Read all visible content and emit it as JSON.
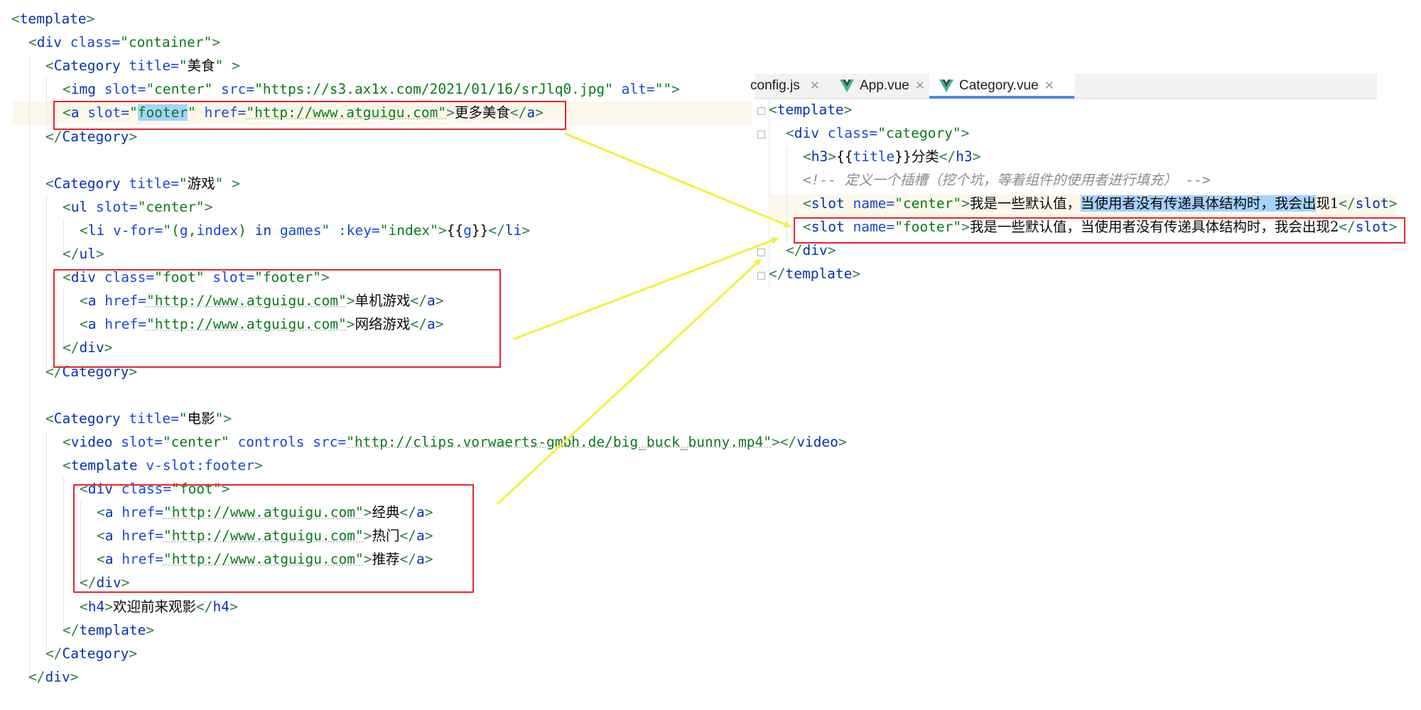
{
  "left_code": [
    [
      {
        "t": "<",
        "c": "bracket"
      },
      {
        "t": "template",
        "c": "tag"
      },
      {
        "t": ">",
        "c": "bracket"
      }
    ],
    [
      {
        "t": "<",
        "c": "bracket"
      },
      {
        "t": "div",
        "c": "tag"
      },
      {
        "t": " class=",
        "c": "attr"
      },
      {
        "t": "\"container\"",
        "c": "str"
      },
      {
        "t": ">",
        "c": "bracket"
      }
    ],
    [
      {
        "t": "<",
        "c": "bracket"
      },
      {
        "t": "Category",
        "c": "tag"
      },
      {
        "t": " title=",
        "c": "attr"
      },
      {
        "t": "\"",
        "c": "str"
      },
      {
        "t": "美食",
        "c": "cjk"
      },
      {
        "t": "\"",
        "c": "str"
      },
      {
        "t": " >",
        "c": "bracket"
      }
    ],
    [
      {
        "t": "<",
        "c": "bracket"
      },
      {
        "t": "img",
        "c": "tag"
      },
      {
        "t": " slot=",
        "c": "attr"
      },
      {
        "t": "\"center\"",
        "c": "str"
      },
      {
        "t": " src=",
        "c": "attr"
      },
      {
        "t": "\"https://s3.ax1x.com/2021/01/16/srJlq0.jpg\"",
        "c": "str"
      },
      {
        "t": " alt=",
        "c": "attr"
      },
      {
        "t": "\"\"",
        "c": "str"
      },
      {
        "t": ">",
        "c": "bracket"
      }
    ],
    [
      {
        "t": "<",
        "c": "bracket"
      },
      {
        "t": "a",
        "c": "tag"
      },
      {
        "t": " slot=",
        "c": "attr"
      },
      {
        "t": "\"",
        "c": "str"
      },
      {
        "t": "footer",
        "c": "str sel"
      },
      {
        "t": "\"",
        "c": "str"
      },
      {
        "t": " href=",
        "c": "attr"
      },
      {
        "t": "\"http://www.atguigu.com\"",
        "c": "str ul"
      },
      {
        "t": ">",
        "c": "bracket"
      },
      {
        "t": "更多美食",
        "c": "cjk"
      },
      {
        "t": "</",
        "c": "bracket"
      },
      {
        "t": "a",
        "c": "tag"
      },
      {
        "t": ">",
        "c": "bracket"
      }
    ],
    [
      {
        "t": "</",
        "c": "bracket"
      },
      {
        "t": "Category",
        "c": "tag"
      },
      {
        "t": ">",
        "c": "bracket"
      }
    ],
    [],
    [
      {
        "t": "<",
        "c": "bracket"
      },
      {
        "t": "Category",
        "c": "tag"
      },
      {
        "t": " title=",
        "c": "attr"
      },
      {
        "t": "\"",
        "c": "str"
      },
      {
        "t": "游戏",
        "c": "cjk"
      },
      {
        "t": "\"",
        "c": "str"
      },
      {
        "t": " >",
        "c": "bracket"
      }
    ],
    [
      {
        "t": "<",
        "c": "bracket"
      },
      {
        "t": "ul",
        "c": "tag"
      },
      {
        "t": " slot=",
        "c": "attr"
      },
      {
        "t": "\"center\"",
        "c": "str"
      },
      {
        "t": ">",
        "c": "bracket"
      }
    ],
    [
      {
        "t": "<",
        "c": "bracket"
      },
      {
        "t": "li",
        "c": "tag"
      },
      {
        "t": " v-for=",
        "c": "attr"
      },
      {
        "t": "\"(",
        "c": "str"
      },
      {
        "t": "g",
        "c": "attr"
      },
      {
        "t": ",",
        "c": "str"
      },
      {
        "t": "index",
        "c": "attr"
      },
      {
        "t": ") ",
        "c": "str"
      },
      {
        "t": "in",
        "c": "tag"
      },
      {
        "t": " games",
        "c": "attr"
      },
      {
        "t": "\"",
        "c": "str"
      },
      {
        "t": " :key=",
        "c": "attr"
      },
      {
        "t": "\"index\"",
        "c": "str"
      },
      {
        "t": ">",
        "c": "bracket"
      },
      {
        "t": "{{",
        "c": "txt"
      },
      {
        "t": "g",
        "c": "attr"
      },
      {
        "t": "}}",
        "c": "txt"
      },
      {
        "t": "</",
        "c": "bracket"
      },
      {
        "t": "li",
        "c": "tag"
      },
      {
        "t": ">",
        "c": "bracket"
      }
    ],
    [
      {
        "t": "</",
        "c": "bracket"
      },
      {
        "t": "ul",
        "c": "tag"
      },
      {
        "t": ">",
        "c": "bracket"
      }
    ],
    [
      {
        "t": "<",
        "c": "bracket"
      },
      {
        "t": "div",
        "c": "tag"
      },
      {
        "t": " class=",
        "c": "attr"
      },
      {
        "t": "\"foot\"",
        "c": "str"
      },
      {
        "t": " slot=",
        "c": "attr"
      },
      {
        "t": "\"footer\"",
        "c": "str"
      },
      {
        "t": ">",
        "c": "bracket"
      }
    ],
    [
      {
        "t": "<",
        "c": "bracket"
      },
      {
        "t": "a",
        "c": "tag"
      },
      {
        "t": " href=",
        "c": "attr"
      },
      {
        "t": "\"http://www.atguigu.com\"",
        "c": "str ul"
      },
      {
        "t": ">",
        "c": "bracket"
      },
      {
        "t": "单机游戏",
        "c": "cjk"
      },
      {
        "t": "</",
        "c": "bracket"
      },
      {
        "t": "a",
        "c": "tag"
      },
      {
        "t": ">",
        "c": "bracket"
      }
    ],
    [
      {
        "t": "<",
        "c": "bracket"
      },
      {
        "t": "a",
        "c": "tag"
      },
      {
        "t": " href=",
        "c": "attr"
      },
      {
        "t": "\"http://www.atguigu.com\"",
        "c": "str ul"
      },
      {
        "t": ">",
        "c": "bracket"
      },
      {
        "t": "网络游戏",
        "c": "cjk"
      },
      {
        "t": "</",
        "c": "bracket"
      },
      {
        "t": "a",
        "c": "tag"
      },
      {
        "t": ">",
        "c": "bracket"
      }
    ],
    [
      {
        "t": "</",
        "c": "bracket"
      },
      {
        "t": "div",
        "c": "tag"
      },
      {
        "t": ">",
        "c": "bracket"
      }
    ],
    [
      {
        "t": "</",
        "c": "bracket"
      },
      {
        "t": "Category",
        "c": "tag"
      },
      {
        "t": ">",
        "c": "bracket"
      }
    ],
    [],
    [
      {
        "t": "<",
        "c": "bracket"
      },
      {
        "t": "Category",
        "c": "tag"
      },
      {
        "t": " title=",
        "c": "attr"
      },
      {
        "t": "\"",
        "c": "str"
      },
      {
        "t": "电影",
        "c": "cjk"
      },
      {
        "t": "\"",
        "c": "str"
      },
      {
        "t": ">",
        "c": "bracket"
      }
    ],
    [
      {
        "t": "<",
        "c": "bracket"
      },
      {
        "t": "video",
        "c": "tag"
      },
      {
        "t": " slot=",
        "c": "attr"
      },
      {
        "t": "\"center\"",
        "c": "str"
      },
      {
        "t": " controls src=",
        "c": "attr"
      },
      {
        "t": "\"http://clips.vorwaerts-gmbh.de/big_buck_bunny.mp4\"",
        "c": "str ul"
      },
      {
        "t": "></",
        "c": "bracket"
      },
      {
        "t": "video",
        "c": "tag"
      },
      {
        "t": ">",
        "c": "bracket"
      }
    ],
    [
      {
        "t": "<",
        "c": "bracket"
      },
      {
        "t": "template",
        "c": "tag"
      },
      {
        "t": " v-slot:footer",
        "c": "attr"
      },
      {
        "t": ">",
        "c": "bracket"
      }
    ],
    [
      {
        "t": "<",
        "c": "bracket"
      },
      {
        "t": "div",
        "c": "tag"
      },
      {
        "t": " class=",
        "c": "attr"
      },
      {
        "t": "\"foot\"",
        "c": "str"
      },
      {
        "t": ">",
        "c": "bracket"
      }
    ],
    [
      {
        "t": "<",
        "c": "bracket"
      },
      {
        "t": "a",
        "c": "tag"
      },
      {
        "t": " href=",
        "c": "attr"
      },
      {
        "t": "\"http://www.atguigu.com\"",
        "c": "str ul"
      },
      {
        "t": ">",
        "c": "bracket"
      },
      {
        "t": "经典",
        "c": "cjk"
      },
      {
        "t": "</",
        "c": "bracket"
      },
      {
        "t": "a",
        "c": "tag"
      },
      {
        "t": ">",
        "c": "bracket"
      }
    ],
    [
      {
        "t": "<",
        "c": "bracket"
      },
      {
        "t": "a",
        "c": "tag"
      },
      {
        "t": " href=",
        "c": "attr"
      },
      {
        "t": "\"http://www.atguigu.com\"",
        "c": "str ul"
      },
      {
        "t": ">",
        "c": "bracket"
      },
      {
        "t": "热门",
        "c": "cjk"
      },
      {
        "t": "</",
        "c": "bracket"
      },
      {
        "t": "a",
        "c": "tag"
      },
      {
        "t": ">",
        "c": "bracket"
      }
    ],
    [
      {
        "t": "<",
        "c": "bracket"
      },
      {
        "t": "a",
        "c": "tag"
      },
      {
        "t": " href=",
        "c": "attr"
      },
      {
        "t": "\"http://www.atguigu.com\"",
        "c": "str ul"
      },
      {
        "t": ">",
        "c": "bracket"
      },
      {
        "t": "推荐",
        "c": "cjk"
      },
      {
        "t": "</",
        "c": "bracket"
      },
      {
        "t": "a",
        "c": "tag"
      },
      {
        "t": ">",
        "c": "bracket"
      }
    ],
    [
      {
        "t": "</",
        "c": "bracket"
      },
      {
        "t": "div",
        "c": "tag"
      },
      {
        "t": ">",
        "c": "bracket"
      }
    ],
    [
      {
        "t": "<",
        "c": "bracket"
      },
      {
        "t": "h4",
        "c": "tag"
      },
      {
        "t": ">",
        "c": "bracket"
      },
      {
        "t": "欢迎前来观影",
        "c": "cjk"
      },
      {
        "t": "</",
        "c": "bracket"
      },
      {
        "t": "h4",
        "c": "tag"
      },
      {
        "t": ">",
        "c": "bracket"
      }
    ],
    [
      {
        "t": "</",
        "c": "bracket"
      },
      {
        "t": "template",
        "c": "tag"
      },
      {
        "t": ">",
        "c": "bracket"
      }
    ],
    [
      {
        "t": "</",
        "c": "bracket"
      },
      {
        "t": "Category",
        "c": "tag"
      },
      {
        "t": ">",
        "c": "bracket"
      }
    ],
    [
      {
        "t": "</",
        "c": "bracket"
      },
      {
        "t": "div",
        "c": "tag"
      },
      {
        "t": ">",
        "c": "bracket"
      }
    ]
  ],
  "tabs": [
    {
      "label": "config.js",
      "icon": "js-file-icon",
      "active": false
    },
    {
      "label": "App.vue",
      "icon": "vue-logo-icon",
      "active": false
    },
    {
      "label": "Category.vue",
      "icon": "vue-logo-icon",
      "active": true
    }
  ],
  "right_code": [
    [
      {
        "t": "<",
        "c": "bracket"
      },
      {
        "t": "template",
        "c": "tag"
      },
      {
        "t": ">",
        "c": "bracket"
      }
    ],
    [
      {
        "t": "<",
        "c": "bracket"
      },
      {
        "t": "div",
        "c": "tag"
      },
      {
        "t": " class=",
        "c": "attr"
      },
      {
        "t": "\"category\"",
        "c": "str"
      },
      {
        "t": ">",
        "c": "bracket"
      }
    ],
    [
      {
        "t": "<",
        "c": "bracket"
      },
      {
        "t": "h3",
        "c": "tag"
      },
      {
        "t": ">",
        "c": "bracket"
      },
      {
        "t": "{{",
        "c": "txt"
      },
      {
        "t": "title",
        "c": "attr"
      },
      {
        "t": "}}",
        "c": "txt"
      },
      {
        "t": "分类",
        "c": "cjk"
      },
      {
        "t": "</",
        "c": "bracket"
      },
      {
        "t": "h3",
        "c": "tag"
      },
      {
        "t": ">",
        "c": "bracket"
      }
    ],
    [
      {
        "t": "<!-- ",
        "c": "cmt"
      },
      {
        "t": "定义一个插槽（挖个坑，等着组件的使用者进行填充）",
        "c": "cmt cjk"
      },
      {
        "t": " -->",
        "c": "cmt"
      }
    ],
    [
      {
        "t": "<",
        "c": "bracket"
      },
      {
        "t": "slot",
        "c": "tag"
      },
      {
        "t": " name=",
        "c": "attr"
      },
      {
        "t": "\"center\"",
        "c": "str"
      },
      {
        "t": ">",
        "c": "bracket"
      },
      {
        "t": "我是一些默认值，",
        "c": "cjk"
      },
      {
        "t": "当使用者没有传递具体结构时，我会出",
        "c": "cjk sel"
      },
      {
        "t": "现1",
        "c": "cjk"
      },
      {
        "t": "</",
        "c": "bracket"
      },
      {
        "t": "slot",
        "c": "tag"
      },
      {
        "t": ">",
        "c": "bracket"
      }
    ],
    [
      {
        "t": "<",
        "c": "bracket"
      },
      {
        "t": "slot",
        "c": "tag"
      },
      {
        "t": " name=",
        "c": "attr"
      },
      {
        "t": "\"footer\"",
        "c": "str"
      },
      {
        "t": ">",
        "c": "bracket"
      },
      {
        "t": "我是一些默认值，当使用者没有传递具体结构时，我会出现2",
        "c": "cjk"
      },
      {
        "t": "</",
        "c": "bracket"
      },
      {
        "t": "slot",
        "c": "tag"
      },
      {
        "t": ">",
        "c": "bracket"
      }
    ],
    [
      {
        "t": "</",
        "c": "bracket"
      },
      {
        "t": "div",
        "c": "tag"
      },
      {
        "t": ">",
        "c": "bracket"
      }
    ],
    [
      {
        "t": "</",
        "c": "bracket"
      },
      {
        "t": "template",
        "c": "tag"
      },
      {
        "t": ">",
        "c": "bracket"
      }
    ]
  ],
  "colors": {
    "tag": "#0033b3",
    "bracket": "#2d7d46",
    "string": "#067d17",
    "selection": "#a6d2ff",
    "red_box": "#e5262c",
    "arrow": "#f5f03a",
    "active_tab_underline": "#4a86e8",
    "vue_green": "#41b883",
    "vue_dark": "#35495e"
  }
}
